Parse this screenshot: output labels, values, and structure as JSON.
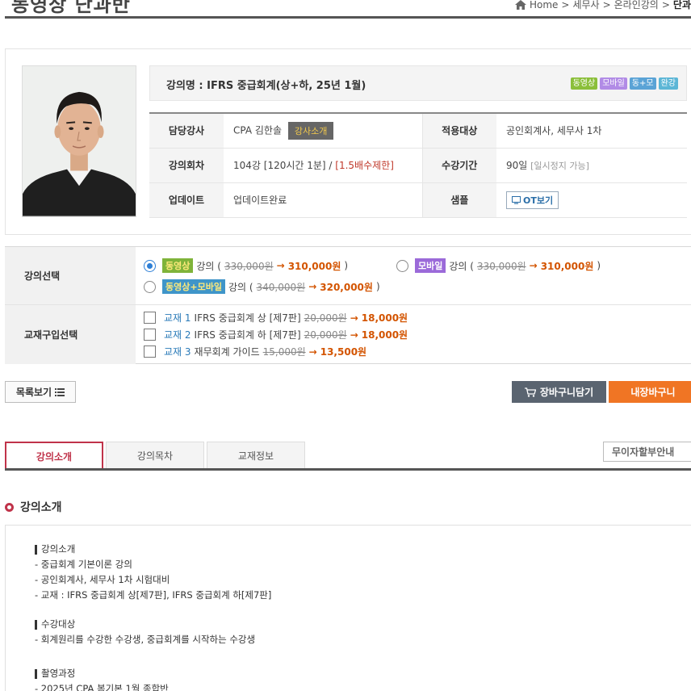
{
  "header": {
    "title": "동영상 단과반",
    "breadcrumb": [
      "Home",
      "세무사",
      "온라인강의"
    ],
    "breadcrumb_current": "단과"
  },
  "course": {
    "title": "강의명 : IFRS 중급회계(상+하, 25년 1월)",
    "badges": [
      "동영상",
      "모바일",
      "동+모",
      "완강"
    ],
    "rows": [
      {
        "label": "담당강사",
        "value": "CPA 김한솔",
        "button": "강사소개",
        "label2": "적용대상",
        "value2": "공인회계사, 세무사 1차"
      },
      {
        "label": "강의회차",
        "value": "104강 [120시간 1분] / ",
        "value_red": "[1.5배수제한]",
        "label2": "수강기간",
        "value2": "90일",
        "value2_gray": "[일시정지 가능]"
      },
      {
        "label": "업데이트",
        "value": "업데이트완료",
        "label2": "샘플",
        "button2": "OT보기"
      }
    ]
  },
  "selection": {
    "lecture_label": "강의선택",
    "options": [
      {
        "tag": "동영상",
        "text": "강의 (",
        "old": "330,000원",
        "arrow": " → ",
        "price": "310,000원",
        "close": ")",
        "selected": true
      },
      {
        "tag": "모바일",
        "text": "강의 (",
        "old": "330,000원",
        "arrow": " → ",
        "price": "310,000원",
        "close": ")",
        "selected": false
      },
      {
        "tag": "동영상+모바일",
        "text": "강의 (",
        "old": "340,000원",
        "arrow": " → ",
        "price": "320,000원",
        "close": ")",
        "selected": false
      }
    ],
    "book_label": "교재구입선택",
    "books": [
      {
        "tag": "교재 1",
        "name": "IFRS 중급회계 상 [제7판]",
        "old": "20,000원",
        "arrow": " → ",
        "price": "18,000원"
      },
      {
        "tag": "교재 2",
        "name": "IFRS 중급회계 하 [제7판]",
        "old": "20,000원",
        "arrow": " → ",
        "price": "18,000원"
      },
      {
        "tag": "교재 3",
        "name": "재무회계 가이드",
        "old": "15,000원",
        "arrow": " → ",
        "price": "13,500원"
      }
    ]
  },
  "actions": {
    "list": "목록보기",
    "cart": "장바구니담기",
    "my_cart": "내장바구니"
  },
  "tabs": [
    "강의소개",
    "강의목차",
    "교재정보"
  ],
  "install_notice": "무이자할부안내",
  "intro": {
    "heading": "강의소개",
    "blocks": [
      {
        "title": "강의소개",
        "lines": [
          "- 중급회계 기본이론 강의",
          "- 공인회계사, 세무사 1차 시험대비",
          "- 교재 : IFRS 중급회계 상[제7판], IFRS 중급회계 하[제7판]"
        ]
      },
      {
        "title": "수강대상",
        "lines": [
          "- 회계원리를 수강한 수강생, 중급회계를 시작하는 수강생"
        ]
      },
      {
        "title": "촬영과정",
        "lines": [
          "- 2025년 CPA 봄기본 1월 종합반"
        ]
      }
    ]
  },
  "colors": {
    "accent_red": "#c0334a",
    "orange": "#f07524",
    "price": "#d35400",
    "cart_dark": "#5a6470"
  }
}
